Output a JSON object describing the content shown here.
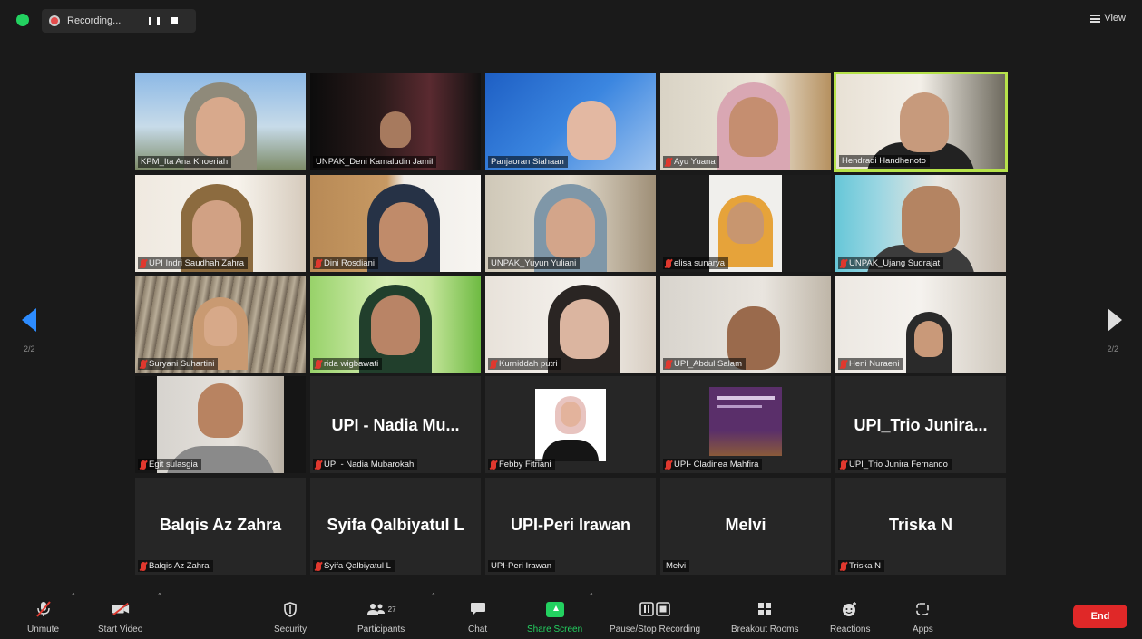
{
  "top_bar": {
    "recording_label": "Recording...",
    "view_label": "View"
  },
  "pagination": {
    "left": "2/2",
    "right": "2/2"
  },
  "participants": [
    {
      "name": "KPM_Ita Ana Khoeriah",
      "muted": false
    },
    {
      "name": "UNPAK_Deni Kamaludin Jamil",
      "muted": false
    },
    {
      "name": "Panjaoran Siahaan",
      "muted": false
    },
    {
      "name": "Ayu Yuana",
      "muted": true
    },
    {
      "name": "Hendradi Handhenoto",
      "muted": false,
      "active_speaker": true
    },
    {
      "name": "UPI Indri Saudhah Zahra",
      "muted": true
    },
    {
      "name": "Dini Rosdiani",
      "muted": true
    },
    {
      "name": "UNPAK_Yuyun Yuliani",
      "muted": false
    },
    {
      "name": "elisa sunarya",
      "muted": true
    },
    {
      "name": "UNPAK_Ujang Sudrajat",
      "muted": true
    },
    {
      "name": "Suryani Suhartini",
      "muted": true
    },
    {
      "name": "rida wigbawati",
      "muted": true
    },
    {
      "name": "Kurniddah putri",
      "muted": true
    },
    {
      "name": "UPI_Abdul Salam",
      "muted": true
    },
    {
      "name": "Heni Nuraeni",
      "muted": true
    },
    {
      "name": "Egit sulasgia",
      "muted": true
    },
    {
      "name": "UPI - Nadia Mubarokah",
      "muted": true,
      "display": "UPI - Nadia Mu..."
    },
    {
      "name": "Febby Fitriani",
      "muted": true
    },
    {
      "name": "UPI- Cladinea Mahfira",
      "muted": true
    },
    {
      "name": "UPI_Trio Junira Fernando",
      "muted": true,
      "display": "UPI_Trio Junira..."
    },
    {
      "name": "Balqis Az Zahra",
      "muted": true,
      "display": "Balqis Az Zahra"
    },
    {
      "name": "Syifa Qalbiyatul L",
      "muted": true,
      "display": "Syifa Qalbiyatul L"
    },
    {
      "name": "UPI-Peri Irawan",
      "muted": false,
      "display": "UPI-Peri Irawan"
    },
    {
      "name": "Melvi",
      "muted": false,
      "display": "Melvi"
    },
    {
      "name": "Triska N",
      "muted": true,
      "display": "Triska N"
    }
  ],
  "toolbar": {
    "unmute": "Unmute",
    "start_video": "Start Video",
    "security": "Security",
    "participants": "Participants",
    "participants_count": "27",
    "chat": "Chat",
    "share_screen": "Share Screen",
    "pause_recording": "Pause/Stop Recording",
    "breakout": "Breakout Rooms",
    "reactions": "Reactions",
    "apps": "Apps",
    "end": "End"
  },
  "colors": {
    "accent": "#2d8cff",
    "share_green": "#23d160",
    "end_red": "#e02828",
    "active_border": "#b6e24a"
  }
}
